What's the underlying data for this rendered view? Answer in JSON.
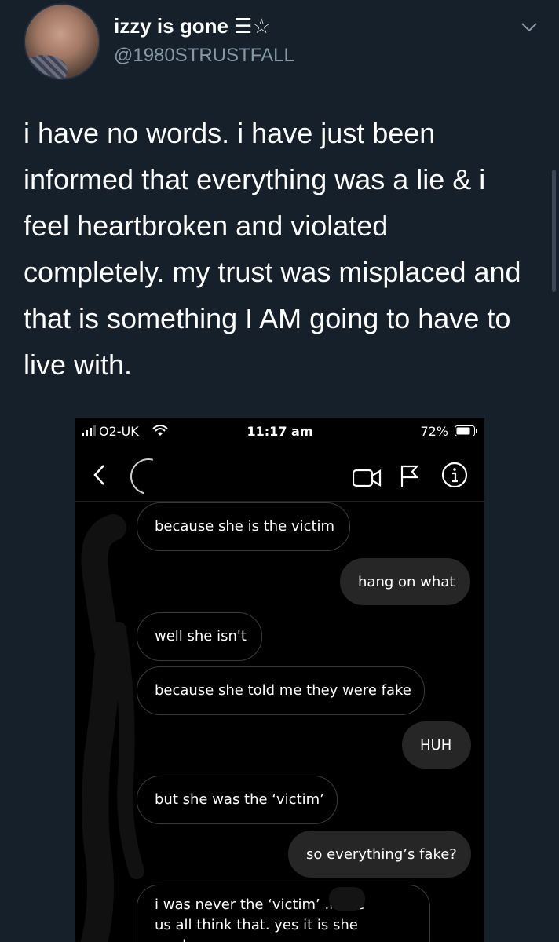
{
  "tweet": {
    "display_name": "izzy is gone",
    "name_suffix": " ☰☆",
    "handle": "@1980STRUSTFALL",
    "text": "i have no words. i have just been informed that everything was a lie & i feel heartbroken and violated completely. my trust was misplaced and that is something I AM going to have to live with."
  },
  "embedded_screenshot": {
    "status_bar": {
      "carrier": "O2-UK",
      "time": "11:17 am",
      "battery": "72%"
    },
    "messages": [
      {
        "from": "them",
        "text": "because she is the victim"
      },
      {
        "from": "me",
        "text": "hang on what"
      },
      {
        "from": "them",
        "text": "well she isn't"
      },
      {
        "from": "them",
        "text": "because she told me they were fake"
      },
      {
        "from": "me",
        "text": "HUH"
      },
      {
        "from": "them",
        "text": "but she was the ‘victim’"
      },
      {
        "from": "me",
        "text": "so everything’s fake?"
      },
      {
        "from": "them",
        "text": "i was never the ‘victim’       .nade us all think that. yes it is she made"
      }
    ]
  },
  "icons": [
    "chevron-down-icon",
    "signal-icon",
    "wifi-icon",
    "battery-icon",
    "back-icon",
    "video-call-icon",
    "flag-icon",
    "info-icon"
  ]
}
